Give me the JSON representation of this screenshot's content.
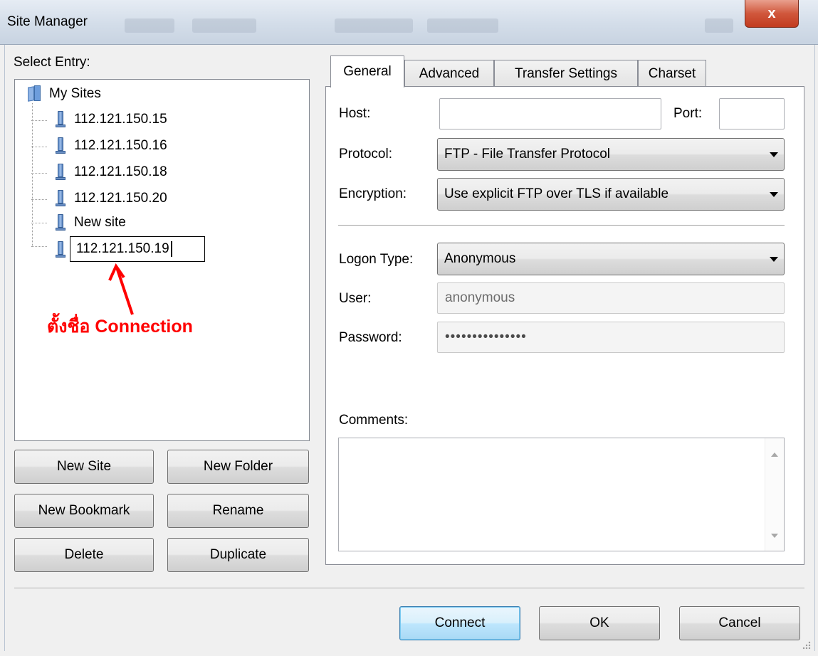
{
  "window": {
    "title": "Site Manager",
    "close_glyph": "x"
  },
  "sidebar": {
    "select_entry_label": "Select Entry:",
    "root_folder": "My Sites",
    "sites": [
      "112.121.150.15",
      "112.121.150.16",
      "112.121.150.18",
      "112.121.150.20",
      "New site"
    ],
    "editing_site_value": "112.121.150.19"
  },
  "annotation": {
    "text": "ตั้งชื่อ Connection",
    "color": "#ff0000"
  },
  "left_buttons": {
    "new_site": "New Site",
    "new_folder": "New Folder",
    "new_bookmark": "New Bookmark",
    "rename": "Rename",
    "delete": "Delete",
    "duplicate": "Duplicate"
  },
  "tabs": [
    {
      "label": "General",
      "active": true
    },
    {
      "label": "Advanced",
      "active": false
    },
    {
      "label": "Transfer Settings",
      "active": false
    },
    {
      "label": "Charset",
      "active": false
    }
  ],
  "general": {
    "host_label": "Host:",
    "host_value": "",
    "port_label": "Port:",
    "port_value": "",
    "protocol_label": "Protocol:",
    "protocol_value": "FTP - File Transfer Protocol",
    "encryption_label": "Encryption:",
    "encryption_value": "Use explicit FTP over TLS if available",
    "logon_type_label": "Logon Type:",
    "logon_type_value": "Anonymous",
    "user_label": "User:",
    "user_value": "anonymous",
    "password_label": "Password:",
    "password_value": "•••••••••••••••",
    "comments_label": "Comments:",
    "comments_value": ""
  },
  "footer": {
    "connect": "Connect",
    "ok": "OK",
    "cancel": "Cancel"
  },
  "colors": {
    "accent_default_button": "#3c7fb1",
    "close_button": "#c23b1f"
  }
}
